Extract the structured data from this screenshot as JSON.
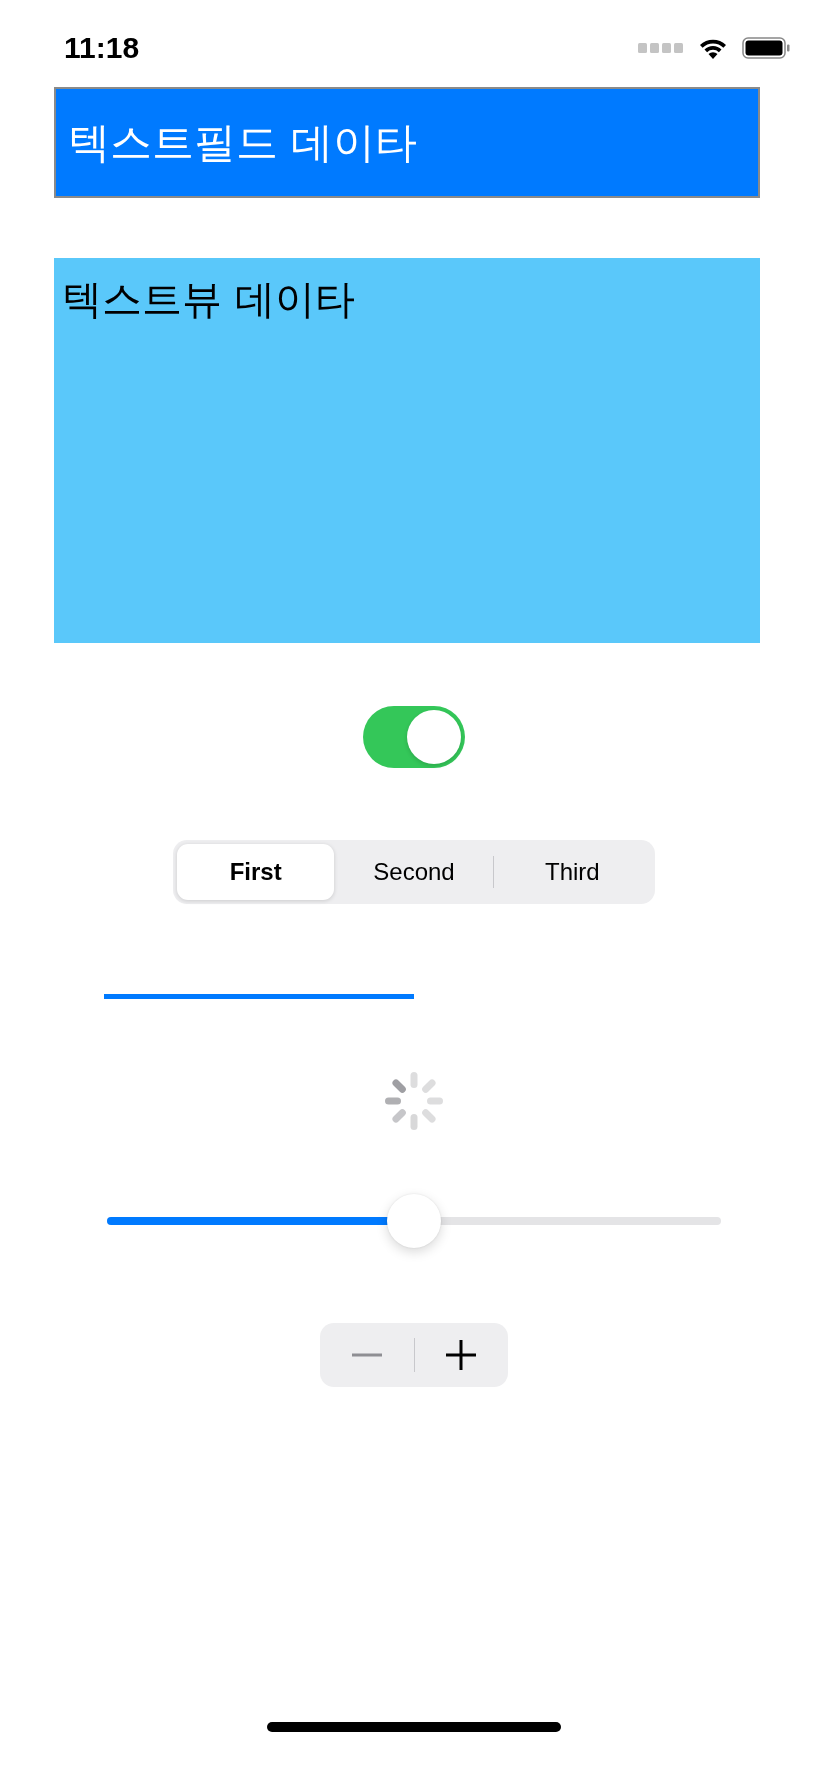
{
  "status_bar": {
    "time": "11:18"
  },
  "text_field": {
    "value": "텍스트필드 데이타"
  },
  "text_view": {
    "text": "텍스트뷰 데이타"
  },
  "switch": {
    "on": true
  },
  "segmented_control": {
    "segments": [
      {
        "label": "First",
        "selected": true
      },
      {
        "label": "Second",
        "selected": false
      },
      {
        "label": "Third",
        "selected": false
      }
    ]
  },
  "progress_bar": {
    "level": 0.5
  },
  "slider": {
    "level": 0.5
  },
  "stepper": {
    "minus_disabled": true,
    "plus_disabled": false
  }
}
